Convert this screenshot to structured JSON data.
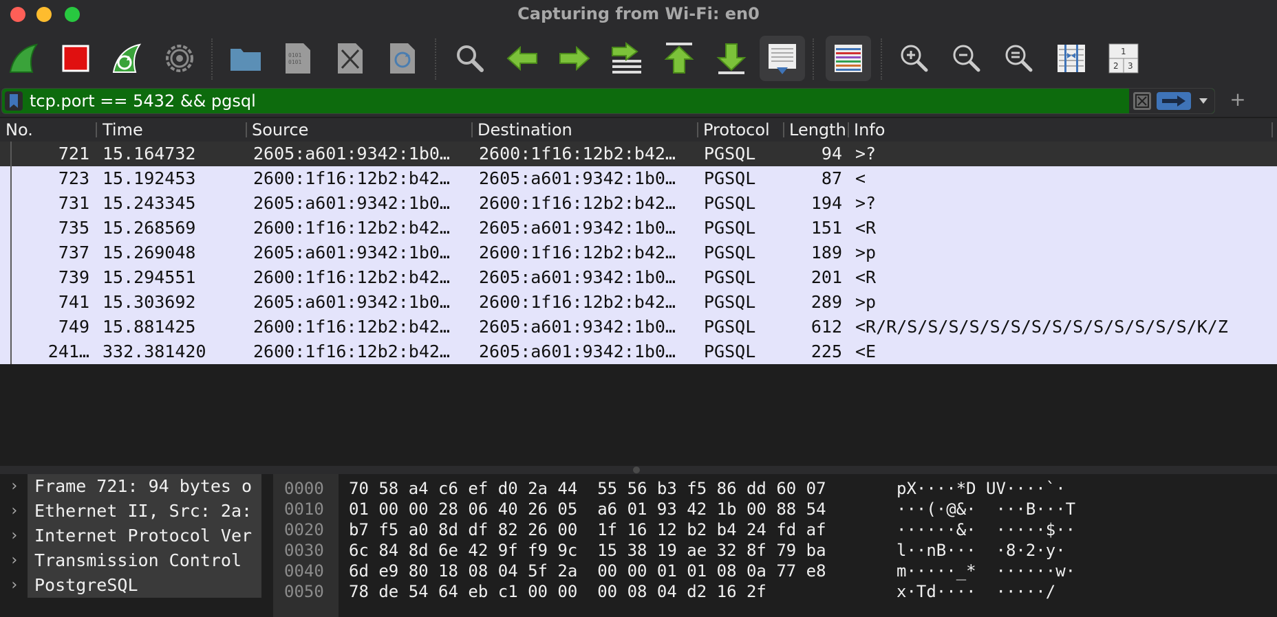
{
  "window": {
    "title": "Capturing from Wi-Fi: en0"
  },
  "toolbar": {
    "buttons": [
      {
        "name": "start-capture-icon"
      },
      {
        "name": "stop-capture-icon"
      },
      {
        "name": "restart-capture-icon"
      },
      {
        "name": "capture-options-icon"
      },
      {
        "name": "open-file-icon"
      },
      {
        "name": "save-file-icon"
      },
      {
        "name": "close-file-icon"
      },
      {
        "name": "reload-file-icon"
      },
      {
        "name": "find-packet-icon"
      },
      {
        "name": "go-back-icon"
      },
      {
        "name": "go-forward-icon"
      },
      {
        "name": "go-to-packet-icon"
      },
      {
        "name": "go-first-icon"
      },
      {
        "name": "go-last-icon"
      },
      {
        "name": "autoscroll-icon"
      },
      {
        "name": "colorize-icon"
      },
      {
        "name": "zoom-in-icon"
      },
      {
        "name": "zoom-out-icon"
      },
      {
        "name": "normal-size-icon"
      },
      {
        "name": "resize-columns-icon"
      },
      {
        "name": "layout-icon"
      }
    ]
  },
  "filter": {
    "value": "tcp.port == 5432 && pgsql",
    "color": "#0d6b0d"
  },
  "packet_list": {
    "columns": [
      "No.",
      "Time",
      "Source",
      "Destination",
      "Protocol",
      "Length",
      "Info"
    ],
    "rows": [
      {
        "no": "721",
        "time": "15.164732",
        "src": "2605:a601:9342:1b0…",
        "dst": "2600:1f16:12b2:b42…",
        "proto": "PGSQL",
        "len": "94",
        "info": ">?"
      },
      {
        "no": "723",
        "time": "15.192453",
        "src": "2600:1f16:12b2:b42…",
        "dst": "2605:a601:9342:1b0…",
        "proto": "PGSQL",
        "len": "87",
        "info": "<"
      },
      {
        "no": "731",
        "time": "15.243345",
        "src": "2605:a601:9342:1b0…",
        "dst": "2600:1f16:12b2:b42…",
        "proto": "PGSQL",
        "len": "194",
        "info": ">?"
      },
      {
        "no": "735",
        "time": "15.268569",
        "src": "2600:1f16:12b2:b42…",
        "dst": "2605:a601:9342:1b0…",
        "proto": "PGSQL",
        "len": "151",
        "info": "<R"
      },
      {
        "no": "737",
        "time": "15.269048",
        "src": "2605:a601:9342:1b0…",
        "dst": "2600:1f16:12b2:b42…",
        "proto": "PGSQL",
        "len": "189",
        "info": ">p"
      },
      {
        "no": "739",
        "time": "15.294551",
        "src": "2600:1f16:12b2:b42…",
        "dst": "2605:a601:9342:1b0…",
        "proto": "PGSQL",
        "len": "201",
        "info": "<R"
      },
      {
        "no": "741",
        "time": "15.303692",
        "src": "2605:a601:9342:1b0…",
        "dst": "2600:1f16:12b2:b42…",
        "proto": "PGSQL",
        "len": "289",
        "info": ">p"
      },
      {
        "no": "749",
        "time": "15.881425",
        "src": "2600:1f16:12b2:b42…",
        "dst": "2605:a601:9342:1b0…",
        "proto": "PGSQL",
        "len": "612",
        "info": "<R/R/S/S/S/S/S/S/S/S/S/S/S/S/S/S/K/Z"
      },
      {
        "no": "241…",
        "time": "332.381420",
        "src": "2600:1f16:12b2:b42…",
        "dst": "2605:a601:9342:1b0…",
        "proto": "PGSQL",
        "len": "225",
        "info": "<E"
      }
    ],
    "row_color": "#e4e4fb",
    "selected_color": "#313131"
  },
  "details": {
    "items": [
      "Frame 721: 94 bytes o",
      "Ethernet II, Src: 2a:",
      "Internet Protocol Ver",
      "Transmission Control",
      "PostgreSQL"
    ]
  },
  "bytes": {
    "rows": [
      {
        "offset": "0000",
        "hex": "70 58 a4 c6 ef d0 2a 44  55 56 b3 f5 86 dd 60 07",
        "ascii": "pX····*D UV····`·"
      },
      {
        "offset": "0010",
        "hex": "01 00 00 28 06 40 26 05  a6 01 93 42 1b 00 88 54",
        "ascii": "···(·@&·  ···B···T"
      },
      {
        "offset": "0020",
        "hex": "b7 f5 a0 8d df 82 26 00  1f 16 12 b2 b4 24 fd af",
        "ascii": "······&·  ·····$··"
      },
      {
        "offset": "0030",
        "hex": "6c 84 8d 6e 42 9f f9 9c  15 38 19 ae 32 8f 79 ba",
        "ascii": "l··nB···  ·8·2·y·"
      },
      {
        "offset": "0040",
        "hex": "6d e9 80 18 08 04 5f 2a  00 00 01 01 08 0a 77 e8",
        "ascii": "m·····_*  ······w·"
      },
      {
        "offset": "0050",
        "hex": "78 de 54 64 eb c1 00 00  00 08 04 d2 16 2f",
        "ascii": "x·Td····  ·····/"
      }
    ]
  }
}
